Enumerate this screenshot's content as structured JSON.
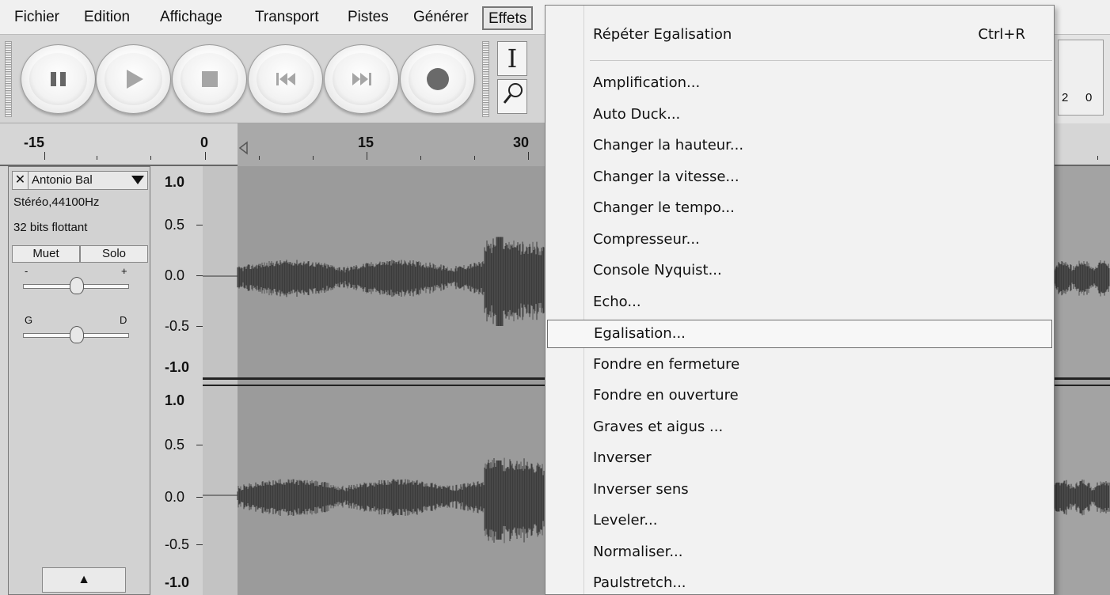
{
  "menubar": {
    "items": [
      "Fichier",
      "Edition",
      "Affichage",
      "Transport",
      "Pistes",
      "Générer",
      "Effets"
    ],
    "active_item": "Effets"
  },
  "toolbar": {
    "buttons": [
      {
        "name": "pause-button",
        "icon": "pause-icon"
      },
      {
        "name": "play-button",
        "icon": "play-icon"
      },
      {
        "name": "stop-button",
        "icon": "stop-icon"
      },
      {
        "name": "skip-start-button",
        "icon": "skip-start-icon"
      },
      {
        "name": "skip-end-button",
        "icon": "skip-end-icon"
      },
      {
        "name": "record-button",
        "icon": "record-icon"
      }
    ],
    "tools": [
      {
        "name": "selection-tool",
        "glyph": "I",
        "icon": "text-cursor-icon"
      },
      {
        "name": "zoom-tool",
        "glyph": "⚲",
        "icon": "magnifier-icon"
      }
    ],
    "meter_labels": [
      "2",
      "0"
    ]
  },
  "ruler": {
    "labels": [
      "-15",
      "0",
      "15",
      "30"
    ]
  },
  "track": {
    "name": "Antonio  Bal",
    "format": "Stéréo,44100Hz",
    "depth": "32 bits flottant",
    "mute_label": "Muet",
    "solo_label": "Solo",
    "gain_minus": "-",
    "gain_plus": "+",
    "pan_left": "G",
    "pan_right": "D",
    "collapse_glyph": "▲"
  },
  "scale": {
    "channel1": [
      "1.0",
      "0.5",
      "0.0",
      "-0.5",
      "-1.0"
    ],
    "channel2": [
      "1.0",
      "0.5",
      "0.0",
      "-0.5",
      "-1.0"
    ]
  },
  "effects_menu": {
    "repeat_label": "Répéter Egalisation",
    "repeat_shortcut": "Ctrl+R",
    "items": [
      "Amplification...",
      "Auto Duck...",
      "Changer la hauteur...",
      "Changer la vitesse...",
      "Changer le tempo...",
      "Compresseur...",
      "Console Nyquist...",
      "Echo...",
      "Egalisation...",
      "Fondre en fermeture",
      "Fondre en ouverture",
      "Graves et aigus ...",
      "Inverser",
      "Inverser sens",
      "Leveler...",
      "Normaliser...",
      "Paulstretch..."
    ],
    "highlighted": "Egalisation..."
  }
}
